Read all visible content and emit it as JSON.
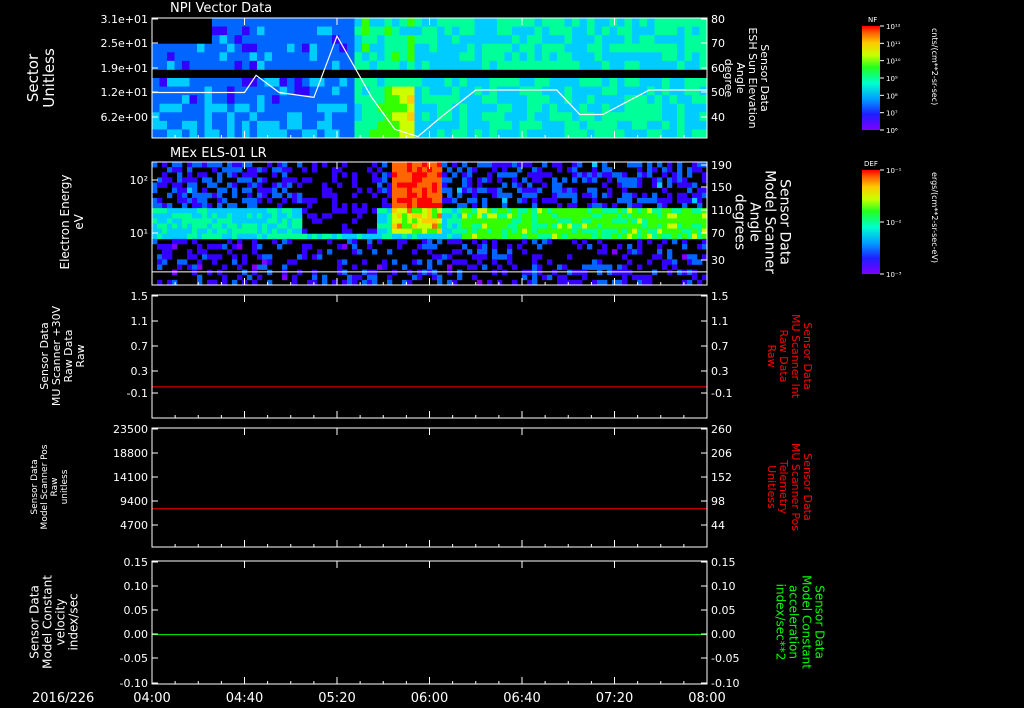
{
  "colors": {
    "background": "#000000",
    "axes": "#ffffff",
    "red_trace": "#ff0000",
    "green_trace": "#00ff00",
    "spectrogram_colormap": [
      "#7f00ff",
      "#3300ff",
      "#0066ff",
      "#00ccff",
      "#00ff99",
      "#33ff00",
      "#ccff00",
      "#ffcc00",
      "#ff6600",
      "#ff0000"
    ]
  },
  "time_axis": {
    "date_label": "2016/226",
    "start": "04:00",
    "end": "08:00",
    "ticks": [
      "04:00",
      "04:40",
      "05:20",
      "06:00",
      "06:40",
      "07:20",
      "08:00"
    ]
  },
  "chart_data": [
    {
      "type": "heatmap",
      "title": "NPI Vector Data",
      "ylabel": "Sector\nUnitless",
      "yticks": [
        "3.1e+01",
        "2.5e+01",
        "1.9e+01",
        "1.2e+01",
        "6.2e+00"
      ],
      "right_ylabel": "Sensor Data\nESH Sun Elevation\nAngle\ndegree",
      "right_yticks": [
        "80",
        "70",
        "60",
        "50",
        "40"
      ],
      "right_ylim": [
        30,
        80
      ],
      "overlay_line": {
        "name": "ESH Sun Elevation Angle",
        "x": [
          "04:00",
          "04:40",
          "04:45",
          "04:55",
          "05:10",
          "05:20",
          "05:35",
          "05:45",
          "05:55",
          "06:05",
          "06:20",
          "06:55",
          "07:05",
          "07:15",
          "07:35",
          "08:00"
        ],
        "y": [
          50,
          50,
          57,
          50,
          48,
          73,
          48,
          35,
          32,
          40,
          51,
          51,
          41,
          41,
          51,
          51
        ]
      },
      "colorbar": {
        "label": "NF",
        "unit": "cnts/(cm**2-sr-sec)",
        "ticks": [
          "10¹²",
          "10¹¹",
          "10¹⁰",
          "10⁹",
          "10⁸",
          "10⁷",
          "10⁶"
        ]
      }
    },
    {
      "type": "heatmap",
      "title": "MEx ELS-01 LR",
      "ylabel": "Electron Energy\neV",
      "yticks": [
        "10²",
        "10¹"
      ],
      "right_ylabel": "Sensor Data\nModel Scanner\nAngle\ndegrees",
      "right_yticks": [
        "190",
        "150",
        "110",
        "70",
        "30"
      ],
      "right_ylim": [
        0,
        190
      ],
      "overlay_line": {
        "name": "Scanner Angle",
        "x": [
          "04:00",
          "08:00"
        ],
        "y": [
          10,
          10
        ]
      },
      "colorbar": {
        "label": "DEF",
        "unit": "ergs/(cm**2-sr-sec-eV)",
        "ticks": [
          "10⁻¹",
          "10⁻²",
          "10⁻³"
        ]
      }
    },
    {
      "type": "line",
      "ylabel": "Sensor Data\nMU Scanner +30V\nRaw Data\nRaw",
      "yticks": [
        "1.5",
        "1.1",
        "0.7",
        "0.3",
        "-0.1"
      ],
      "ylim": [
        -0.5,
        1.5
      ],
      "right_ylabel": "Sensor Data\nMU Scanner Int\nRaw Data\nRaw",
      "right_yticks": [
        "1.5",
        "1.1",
        "0.7",
        "0.3",
        "-0.1"
      ],
      "series": [
        {
          "color": "#ff0000",
          "x": [
            "04:00",
            "08:00"
          ],
          "y": [
            0,
            0
          ]
        }
      ]
    },
    {
      "type": "line",
      "ylabel": "Sensor Data\nModel Scanner Pos\nRaw\nunitless",
      "yticks": [
        "23500",
        "18800",
        "14100",
        "9400",
        "4700"
      ],
      "ylim": [
        0,
        23500
      ],
      "right_ylabel": "Sensor Data\nMU Scanner Pos\nTelemetry\nUnitless",
      "right_yticks": [
        "260",
        "206",
        "152",
        "98",
        "44"
      ],
      "series": [
        {
          "color": "#ff0000",
          "x": [
            "04:00",
            "08:00"
          ],
          "y": [
            7900,
            7900
          ]
        }
      ]
    },
    {
      "type": "line",
      "ylabel": "Sensor Data\nModel Constant\nvelocity\nindex/sec",
      "yticks": [
        "0.15",
        "0.10",
        "0.05",
        "0.00",
        "-0.05",
        "-0.10"
      ],
      "ylim": [
        -0.1,
        0.15
      ],
      "right_ylabel": "Sensor Data\nModel Constant\nacceleration\nindex/sec**2",
      "right_yticks": [
        "0.15",
        "0.10",
        "0.05",
        "0.00",
        "-0.05",
        "-0.10"
      ],
      "series": [
        {
          "color": "#00ff00",
          "x": [
            "04:00",
            "08:00"
          ],
          "y": [
            0,
            0
          ]
        }
      ]
    }
  ]
}
